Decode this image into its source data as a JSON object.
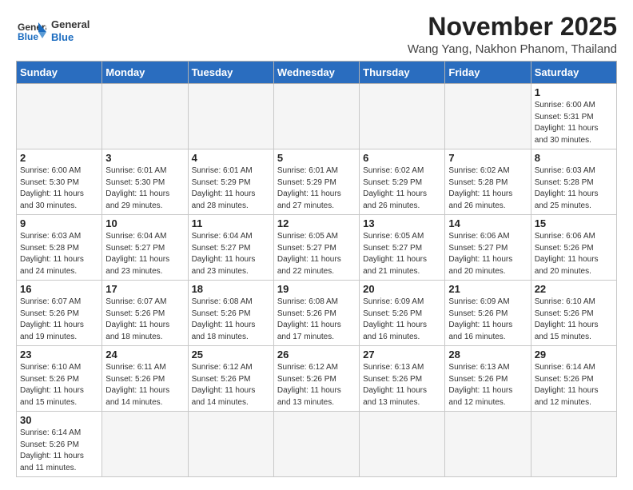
{
  "logo": {
    "line1": "General",
    "line2": "Blue"
  },
  "title": "November 2025",
  "subtitle": "Wang Yang, Nakhon Phanom, Thailand",
  "weekdays": [
    "Sunday",
    "Monday",
    "Tuesday",
    "Wednesday",
    "Thursday",
    "Friday",
    "Saturday"
  ],
  "days": [
    {
      "day": "",
      "info": ""
    },
    {
      "day": "",
      "info": ""
    },
    {
      "day": "",
      "info": ""
    },
    {
      "day": "",
      "info": ""
    },
    {
      "day": "",
      "info": ""
    },
    {
      "day": "",
      "info": ""
    },
    {
      "day": "1",
      "info": "Sunrise: 6:00 AM\nSunset: 5:31 PM\nDaylight: 11 hours\nand 30 minutes."
    },
    {
      "day": "2",
      "info": "Sunrise: 6:00 AM\nSunset: 5:30 PM\nDaylight: 11 hours\nand 30 minutes."
    },
    {
      "day": "3",
      "info": "Sunrise: 6:01 AM\nSunset: 5:30 PM\nDaylight: 11 hours\nand 29 minutes."
    },
    {
      "day": "4",
      "info": "Sunrise: 6:01 AM\nSunset: 5:29 PM\nDaylight: 11 hours\nand 28 minutes."
    },
    {
      "day": "5",
      "info": "Sunrise: 6:01 AM\nSunset: 5:29 PM\nDaylight: 11 hours\nand 27 minutes."
    },
    {
      "day": "6",
      "info": "Sunrise: 6:02 AM\nSunset: 5:29 PM\nDaylight: 11 hours\nand 26 minutes."
    },
    {
      "day": "7",
      "info": "Sunrise: 6:02 AM\nSunset: 5:28 PM\nDaylight: 11 hours\nand 26 minutes."
    },
    {
      "day": "8",
      "info": "Sunrise: 6:03 AM\nSunset: 5:28 PM\nDaylight: 11 hours\nand 25 minutes."
    },
    {
      "day": "9",
      "info": "Sunrise: 6:03 AM\nSunset: 5:28 PM\nDaylight: 11 hours\nand 24 minutes."
    },
    {
      "day": "10",
      "info": "Sunrise: 6:04 AM\nSunset: 5:27 PM\nDaylight: 11 hours\nand 23 minutes."
    },
    {
      "day": "11",
      "info": "Sunrise: 6:04 AM\nSunset: 5:27 PM\nDaylight: 11 hours\nand 23 minutes."
    },
    {
      "day": "12",
      "info": "Sunrise: 6:05 AM\nSunset: 5:27 PM\nDaylight: 11 hours\nand 22 minutes."
    },
    {
      "day": "13",
      "info": "Sunrise: 6:05 AM\nSunset: 5:27 PM\nDaylight: 11 hours\nand 21 minutes."
    },
    {
      "day": "14",
      "info": "Sunrise: 6:06 AM\nSunset: 5:27 PM\nDaylight: 11 hours\nand 20 minutes."
    },
    {
      "day": "15",
      "info": "Sunrise: 6:06 AM\nSunset: 5:26 PM\nDaylight: 11 hours\nand 20 minutes."
    },
    {
      "day": "16",
      "info": "Sunrise: 6:07 AM\nSunset: 5:26 PM\nDaylight: 11 hours\nand 19 minutes."
    },
    {
      "day": "17",
      "info": "Sunrise: 6:07 AM\nSunset: 5:26 PM\nDaylight: 11 hours\nand 18 minutes."
    },
    {
      "day": "18",
      "info": "Sunrise: 6:08 AM\nSunset: 5:26 PM\nDaylight: 11 hours\nand 18 minutes."
    },
    {
      "day": "19",
      "info": "Sunrise: 6:08 AM\nSunset: 5:26 PM\nDaylight: 11 hours\nand 17 minutes."
    },
    {
      "day": "20",
      "info": "Sunrise: 6:09 AM\nSunset: 5:26 PM\nDaylight: 11 hours\nand 16 minutes."
    },
    {
      "day": "21",
      "info": "Sunrise: 6:09 AM\nSunset: 5:26 PM\nDaylight: 11 hours\nand 16 minutes."
    },
    {
      "day": "22",
      "info": "Sunrise: 6:10 AM\nSunset: 5:26 PM\nDaylight: 11 hours\nand 15 minutes."
    },
    {
      "day": "23",
      "info": "Sunrise: 6:10 AM\nSunset: 5:26 PM\nDaylight: 11 hours\nand 15 minutes."
    },
    {
      "day": "24",
      "info": "Sunrise: 6:11 AM\nSunset: 5:26 PM\nDaylight: 11 hours\nand 14 minutes."
    },
    {
      "day": "25",
      "info": "Sunrise: 6:12 AM\nSunset: 5:26 PM\nDaylight: 11 hours\nand 14 minutes."
    },
    {
      "day": "26",
      "info": "Sunrise: 6:12 AM\nSunset: 5:26 PM\nDaylight: 11 hours\nand 13 minutes."
    },
    {
      "day": "27",
      "info": "Sunrise: 6:13 AM\nSunset: 5:26 PM\nDaylight: 11 hours\nand 13 minutes."
    },
    {
      "day": "28",
      "info": "Sunrise: 6:13 AM\nSunset: 5:26 PM\nDaylight: 11 hours\nand 12 minutes."
    },
    {
      "day": "29",
      "info": "Sunrise: 6:14 AM\nSunset: 5:26 PM\nDaylight: 11 hours\nand 12 minutes."
    },
    {
      "day": "30",
      "info": "Sunrise: 6:14 AM\nSunset: 5:26 PM\nDaylight: 11 hours\nand 11 minutes."
    },
    {
      "day": "",
      "info": ""
    },
    {
      "day": "",
      "info": ""
    },
    {
      "day": "",
      "info": ""
    },
    {
      "day": "",
      "info": ""
    },
    {
      "day": "",
      "info": ""
    },
    {
      "day": "",
      "info": ""
    }
  ]
}
